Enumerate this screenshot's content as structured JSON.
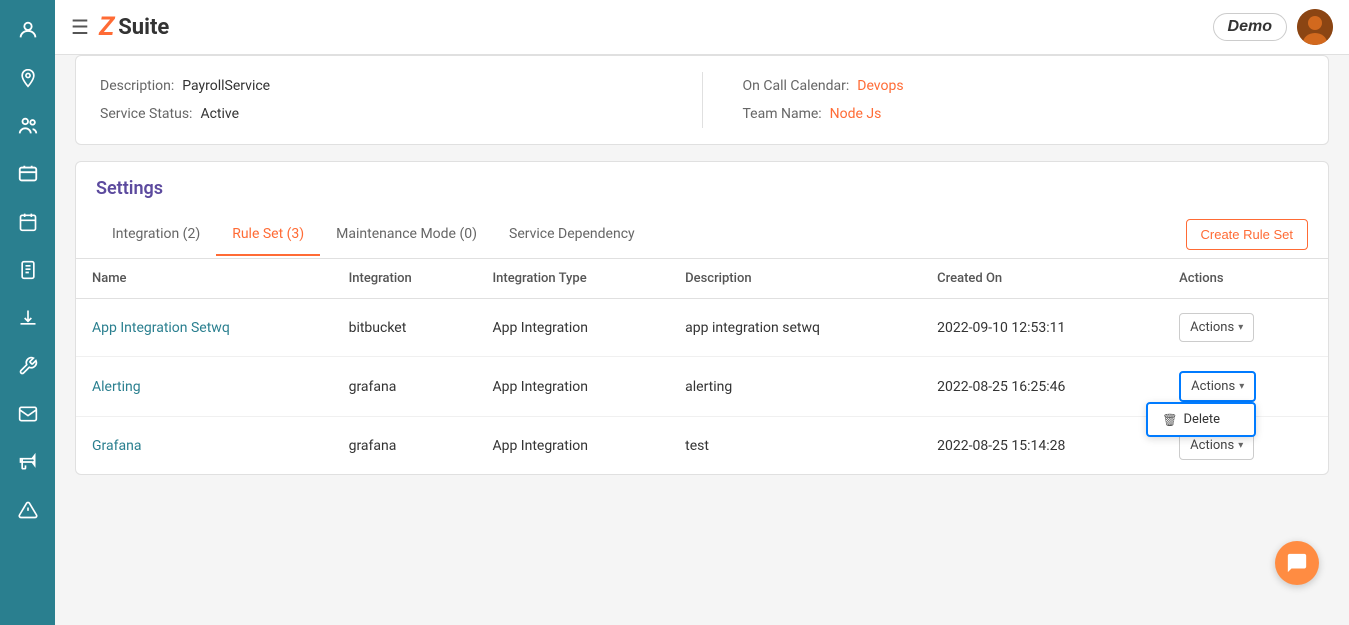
{
  "topbar": {
    "hamburger_label": "☰",
    "logo_z": "Z",
    "logo_suite": "Suite",
    "demo_label": "Demo",
    "create_ruleset_label": "Create Rule Set"
  },
  "info_section": {
    "description_label": "Description:",
    "description_value": "PayrollService",
    "on_call_calendar_label": "On Call Calendar:",
    "on_call_calendar_value": "Devops",
    "service_status_label": "Service Status:",
    "service_status_value": "Active",
    "team_name_label": "Team Name:",
    "team_name_value": "Node Js"
  },
  "settings": {
    "title": "Settings",
    "tabs": [
      {
        "label": "Integration (2)",
        "active": false
      },
      {
        "label": "Rule Set (3)",
        "active": true
      },
      {
        "label": "Maintenance Mode (0)",
        "active": false
      },
      {
        "label": "Service Dependency",
        "active": false
      }
    ],
    "table": {
      "headers": [
        "Name",
        "Integration",
        "Integration Type",
        "Description",
        "Created On",
        "Actions"
      ],
      "rows": [
        {
          "name": "App Integration Setwq",
          "integration": "bitbucket",
          "integration_type": "App Integration",
          "description": "app integration setwq",
          "created_on": "2022-09-10 12:53:11",
          "actions": "dropdown",
          "dropdown_open": false
        },
        {
          "name": "Alerting",
          "integration": "grafana",
          "integration_type": "App Integration",
          "description": "alerting",
          "created_on": "2022-08-25 16:25:46",
          "actions": "dropdown",
          "dropdown_open": true
        },
        {
          "name": "Grafana",
          "integration": "grafana",
          "integration_type": "App Integration",
          "description": "test",
          "created_on": "2022-08-25 15:14:28",
          "actions": "dropdown",
          "dropdown_open": false
        }
      ]
    }
  },
  "actions_label": "Actions",
  "delete_label": "Delete",
  "dropdown_arrow": "▾",
  "sidebar_icons": [
    "👤",
    "📍",
    "😊",
    "👥",
    "📅",
    "📄",
    "⬇",
    "🔧",
    "✉",
    "📢",
    "⚠"
  ],
  "chat_icon": "💬"
}
